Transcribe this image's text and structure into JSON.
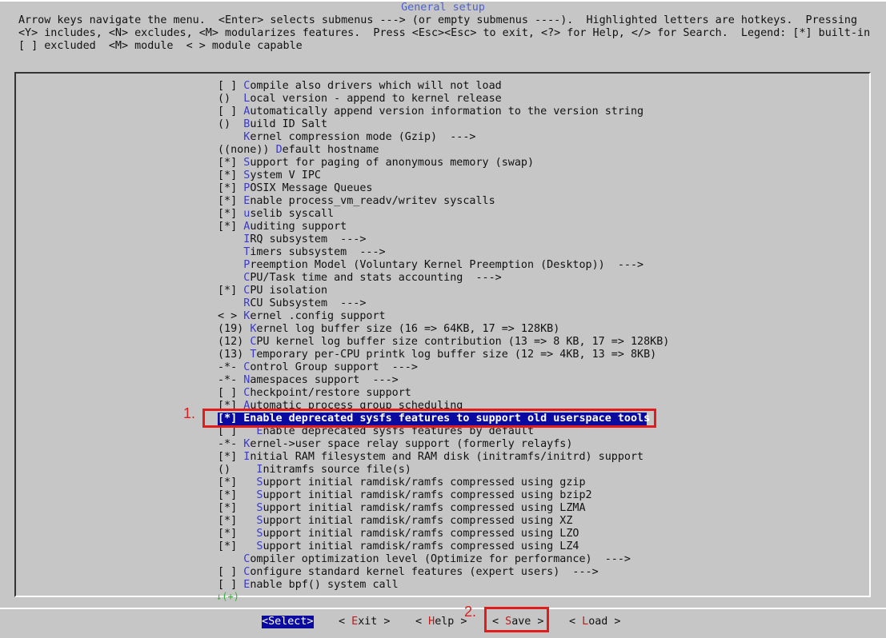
{
  "window": {
    "title": "General setup"
  },
  "help_text": "Arrow keys navigate the menu.  <Enter> selects submenus ---> (or empty submenus ----).  Highlighted letters are hotkeys.  Pressing <Y> includes, <N> excludes, <M> modularizes features.  Press <Esc><Esc> to exit, <?> for Help, </> for Search.  Legend: [*] built-in  [ ] excluded  <M> module  < > module capable",
  "menu": [
    {
      "prefix": "[ ] ",
      "hotkey": "C",
      "rest": "ompile also drivers which will not load"
    },
    {
      "prefix": "()  ",
      "hotkey": "L",
      "rest": "ocal version - append to kernel release"
    },
    {
      "prefix": "[ ] ",
      "hotkey": "A",
      "rest": "utomatically append version information to the version string"
    },
    {
      "prefix": "()  ",
      "hotkey": "B",
      "rest": "uild ID Salt"
    },
    {
      "prefix": "    ",
      "hotkey": "K",
      "rest": "ernel compression mode (Gzip)  --->"
    },
    {
      "prefix": "((none)) ",
      "hotkey": "D",
      "rest": "efault hostname"
    },
    {
      "prefix": "[*] ",
      "hotkey": "S",
      "rest": "upport for paging of anonymous memory (swap)"
    },
    {
      "prefix": "[*] ",
      "hotkey": "S",
      "rest": "ystem V IPC"
    },
    {
      "prefix": "[*] ",
      "hotkey": "P",
      "rest": "OSIX Message Queues"
    },
    {
      "prefix": "[*] ",
      "hotkey": "E",
      "rest": "nable process_vm_readv/writev syscalls"
    },
    {
      "prefix": "[*] ",
      "hotkey": "u",
      "rest": "selib syscall"
    },
    {
      "prefix": "[*] ",
      "hotkey": "A",
      "rest": "uditing support"
    },
    {
      "prefix": "    ",
      "hotkey": "I",
      "rest": "RQ subsystem  --->"
    },
    {
      "prefix": "    ",
      "hotkey": "T",
      "rest": "imers subsystem  --->"
    },
    {
      "prefix": "    ",
      "hotkey": "P",
      "rest": "reemption Model (Voluntary Kernel Preemption (Desktop))  --->"
    },
    {
      "prefix": "    ",
      "hotkey": "C",
      "rest": "PU/Task time and stats accounting  --->"
    },
    {
      "prefix": "[*] ",
      "hotkey": "C",
      "rest": "PU isolation"
    },
    {
      "prefix": "    ",
      "hotkey": "R",
      "rest": "CU Subsystem  --->"
    },
    {
      "prefix": "< > ",
      "hotkey": "K",
      "rest": "ernel .config support"
    },
    {
      "prefix": "(19) ",
      "hotkey": "K",
      "rest": "ernel log buffer size (16 => 64KB, 17 => 128KB)"
    },
    {
      "prefix": "(12) ",
      "hotkey": "C",
      "rest": "PU kernel log buffer size contribution (13 => 8 KB, 17 => 128KB)"
    },
    {
      "prefix": "(13) ",
      "hotkey": "T",
      "rest": "emporary per-CPU printk log buffer size (12 => 4KB, 13 => 8KB)"
    },
    {
      "prefix": "-*- ",
      "hotkey": "C",
      "rest": "ontrol Group support  --->"
    },
    {
      "prefix": "-*- ",
      "hotkey": "N",
      "rest": "amespaces support  --->"
    },
    {
      "prefix": "[ ] ",
      "hotkey": "C",
      "rest": "heckpoint/restore support"
    },
    {
      "prefix": "[*] ",
      "hotkey": "A",
      "rest": "utomatic process group scheduling"
    },
    {
      "prefix": "[*] ",
      "hotkey": "",
      "rest": "Enable deprecated sysfs features to support old userspace tools"
    },
    {
      "prefix": "[ ]   ",
      "hotkey": "E",
      "rest": "nable deprecated sysfs features by default"
    },
    {
      "prefix": "-*- ",
      "hotkey": "K",
      "rest": "ernel->user space relay support (formerly relayfs)"
    },
    {
      "prefix": "[*] ",
      "hotkey": "I",
      "rest": "nitial RAM filesystem and RAM disk (initramfs/initrd) support"
    },
    {
      "prefix": "()    ",
      "hotkey": "I",
      "rest": "nitramfs source file(s)"
    },
    {
      "prefix": "[*]   ",
      "hotkey": "S",
      "rest": "upport initial ramdisk/ramfs compressed using gzip"
    },
    {
      "prefix": "[*]   ",
      "hotkey": "S",
      "rest": "upport initial ramdisk/ramfs compressed using bzip2"
    },
    {
      "prefix": "[*]   ",
      "hotkey": "S",
      "rest": "upport initial ramdisk/ramfs compressed using LZMA"
    },
    {
      "prefix": "[*]   ",
      "hotkey": "S",
      "rest": "upport initial ramdisk/ramfs compressed using XZ"
    },
    {
      "prefix": "[*]   ",
      "hotkey": "S",
      "rest": "upport initial ramdisk/ramfs compressed using LZO"
    },
    {
      "prefix": "[*]   ",
      "hotkey": "S",
      "rest": "upport initial ramdisk/ramfs compressed using LZ4"
    },
    {
      "prefix": "    ",
      "hotkey": "C",
      "rest": "ompiler optimization level (Optimize for performance)  --->"
    },
    {
      "prefix": "[ ] ",
      "hotkey": "C",
      "rest": "onfigure standard kernel features (expert users)  --->"
    },
    {
      "prefix": "[ ] ",
      "hotkey": "E",
      "rest": "nable bpf() system call"
    }
  ],
  "selected_index": 26,
  "more_indicator": "↓(+)",
  "buttons": {
    "select": {
      "pre": "<",
      "hk": "S",
      "post": "elect>"
    },
    "exit": {
      "pre": "< ",
      "hk": "E",
      "post": "xit >"
    },
    "help": {
      "pre": "< ",
      "hk": "H",
      "post": "elp >"
    },
    "save": {
      "pre": "< ",
      "hk": "S",
      "post": "ave >"
    },
    "load": {
      "pre": "< ",
      "hk": "L",
      "post": "oad >"
    }
  },
  "annotations": {
    "one": "1.",
    "two": "2."
  },
  "colors": {
    "background": "#c6c6c6",
    "selection": "#0a0aa0",
    "hotkey": "#3a3acc",
    "button_hotkey": "#c01818",
    "annotation": "#e21c1c"
  }
}
